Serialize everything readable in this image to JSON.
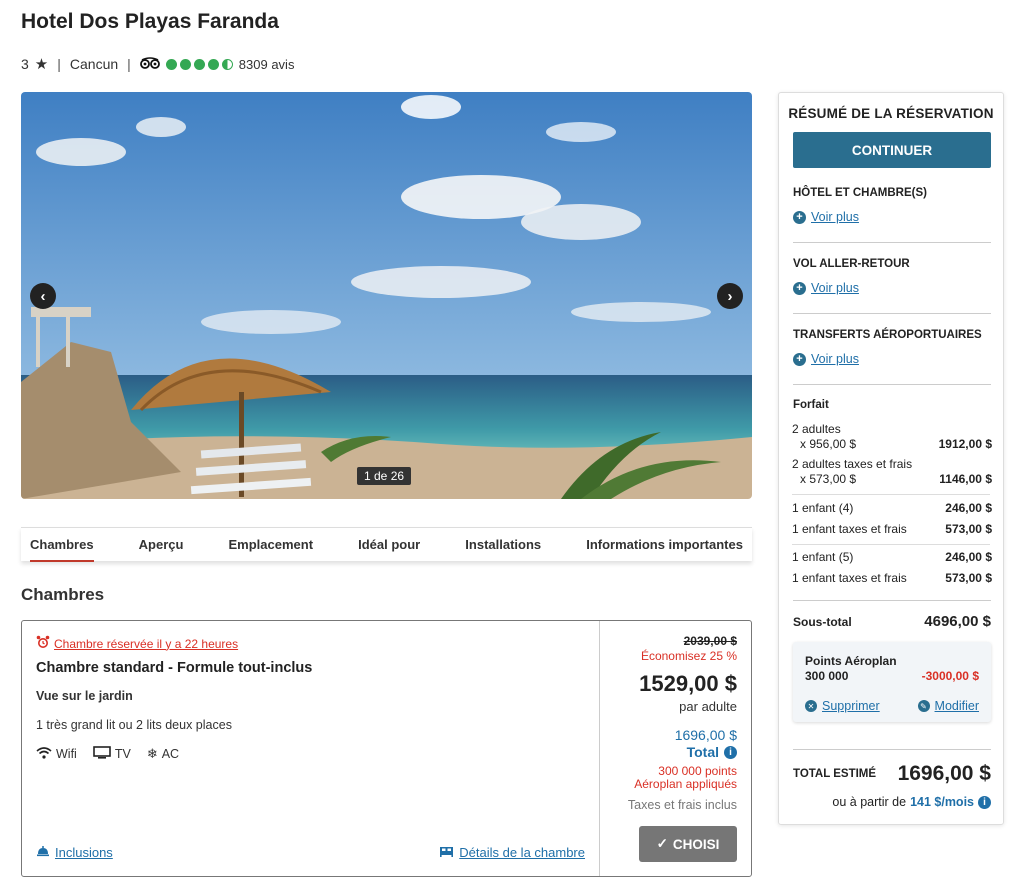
{
  "hotel": {
    "name": "Hotel Dos Playas Faranda",
    "stars": "3",
    "city": "Cancun",
    "reviews": "8309 avis"
  },
  "gallery": {
    "counter": "1 de 26"
  },
  "tabs": [
    "Chambres",
    "Aperçu",
    "Emplacement",
    "Idéal pour",
    "Installations",
    "Informations importantes"
  ],
  "rooms_section": {
    "title": "Chambres"
  },
  "room": {
    "reserved": "Chambre réservée il y a 22 heures",
    "name": "Chambre standard - Formule tout-inclus",
    "view": "Vue sur le jardin",
    "beds": "1 très grand lit ou 2 lits deux places",
    "amenities": [
      "Wifi",
      "TV",
      "AC"
    ],
    "inclusions": "Inclusions",
    "details": "Détails de la chambre",
    "old_price": "2039,00 $",
    "savings": "Économisez 25 %",
    "price": "1529,00 $",
    "per": "par adulte",
    "total_value": "1696,00 $",
    "total_label": "Total",
    "points_line1": "300 000 points",
    "points_line2": "Aéroplan appliqués",
    "taxes": "Taxes et frais inclus",
    "chosen": "CHOISI"
  },
  "summary": {
    "title": "RÉSUMÉ DE LA RÉSERVATION",
    "continue": "CONTINUER",
    "hotel_rooms": "HÔTEL ET CHAMBRE(S)",
    "flight": "VOL ALLER-RETOUR",
    "transfers": "TRANSFERTS AÉROPORTUAIRES",
    "see_more": "Voir plus",
    "package": "Forfait",
    "adults": "2 adultes",
    "adults_unit": "x 956,00 $",
    "adults_total": "1912,00 $",
    "adults_tax": "2 adultes taxes et frais",
    "adults_tax_unit": "x 573,00 $",
    "adults_tax_total": "1146,00 $",
    "child1": "1 enfant (4)",
    "child1_val": "246,00 $",
    "child1_tax": "1 enfant taxes et frais",
    "child1_tax_val": "573,00 $",
    "child2": "1 enfant (5)",
    "child2_val": "246,00 $",
    "child2_tax": "1 enfant taxes et frais",
    "child2_tax_val": "573,00 $",
    "subtotal_label": "Sous-total",
    "subtotal": "4696,00 $",
    "aeroplan_title": "Points Aéroplan",
    "aeroplan_points": "300 000",
    "aeroplan_value": "-3000,00 $",
    "remove": "Supprimer",
    "modify": "Modifier",
    "est_label": "TOTAL ESTIMÉ",
    "est_total": "1696,00 $",
    "monthly_prefix": "ou à partir de",
    "monthly": "141 $/mois"
  },
  "colors": {
    "accent": "#2a6e8f",
    "link": "#1f6fa8",
    "alert": "#d93025",
    "rating": "#34a853"
  }
}
